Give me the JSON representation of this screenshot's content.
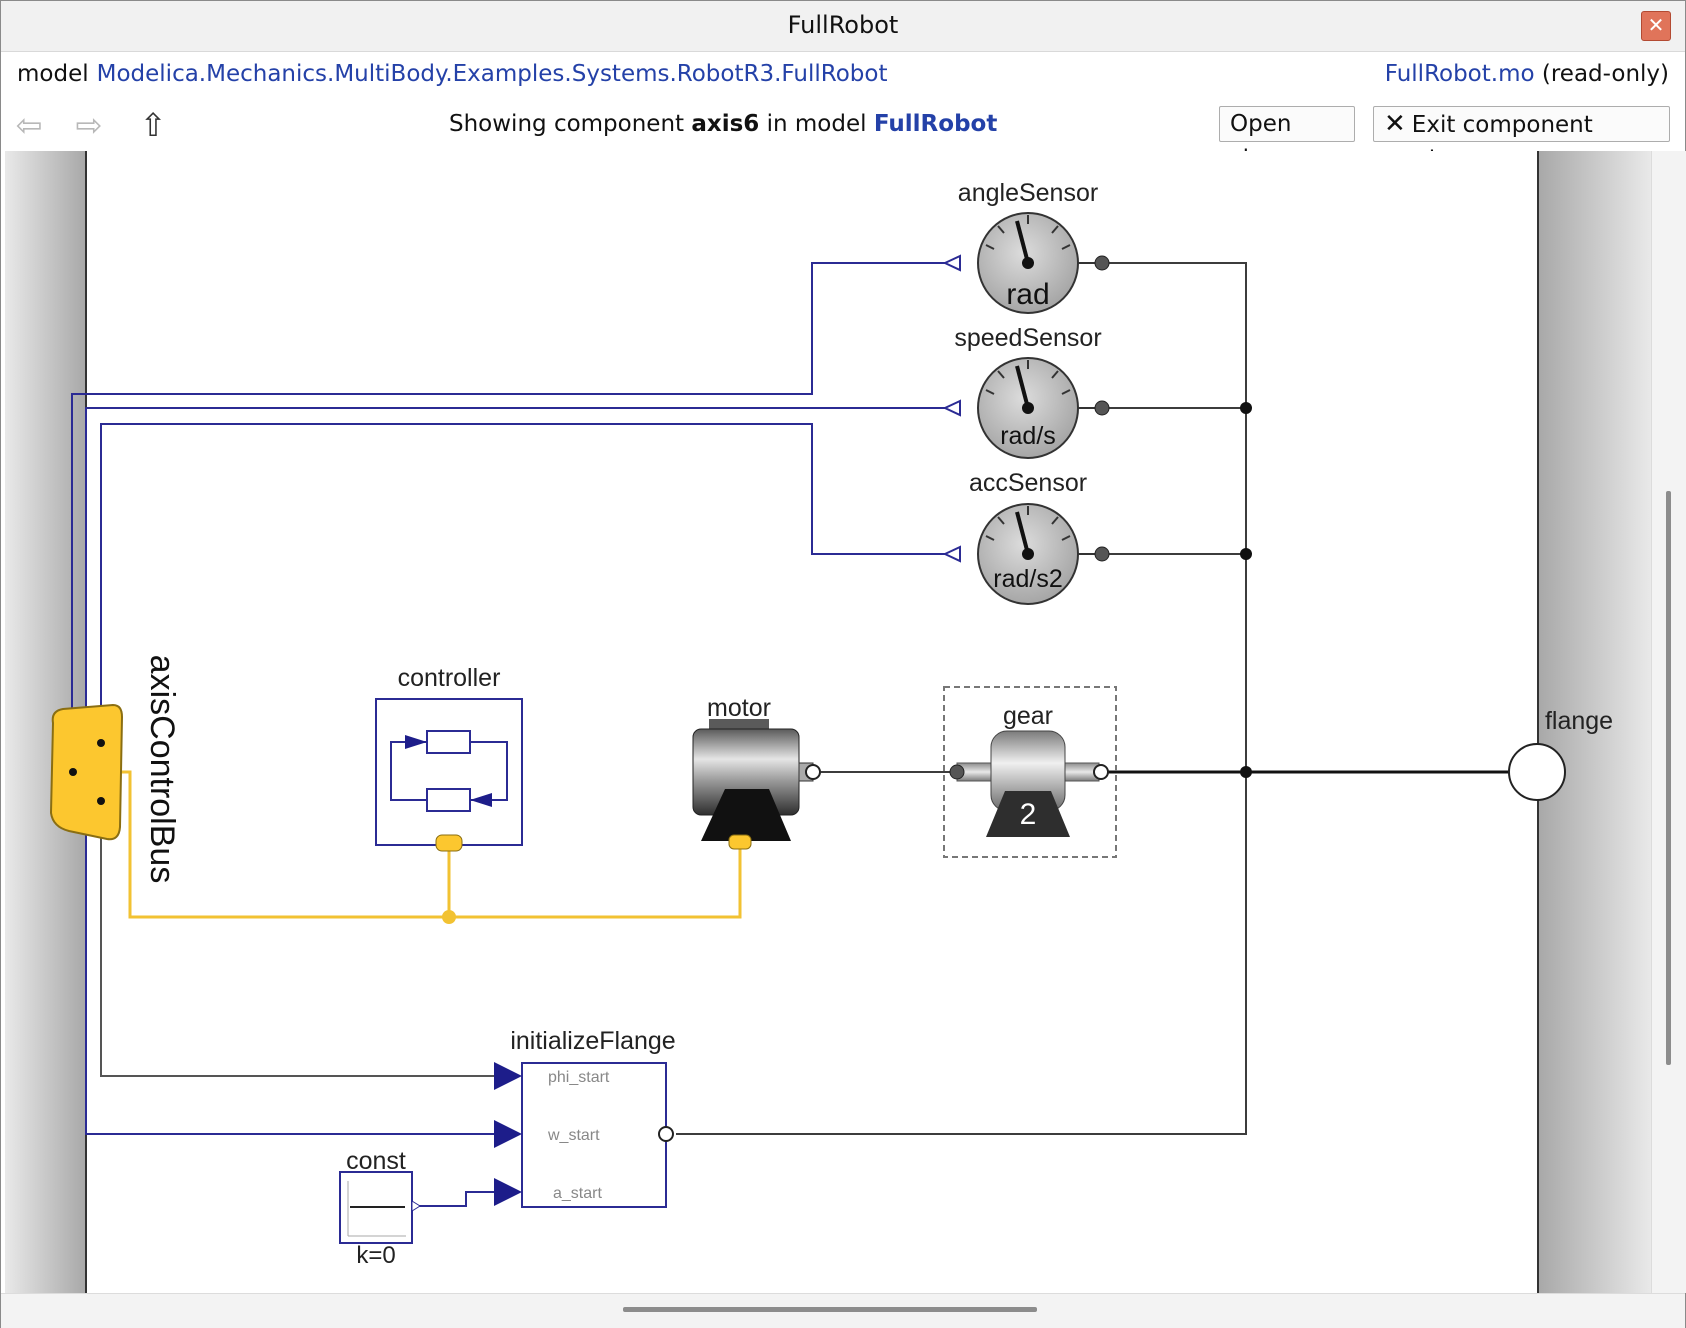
{
  "window": {
    "title": "FullRobot"
  },
  "path": {
    "keyword": "model",
    "class_path": "Modelica.Mechanics.MultiBody.Examples.Systems.RobotR3.FullRobot",
    "file": "FullRobot.mo",
    "file_status": "(read-only)"
  },
  "nav": {
    "back_icon": "arrow-left-icon",
    "forward_icon": "arrow-right-icon",
    "up_icon": "arrow-up-icon",
    "status_prefix": "Showing component",
    "component": "axis6",
    "status_middle": "in model",
    "model": "FullRobot",
    "open_class": "Open class",
    "exit_mode": "Exit component mode"
  },
  "diagram": {
    "components": {
      "angle_sensor": {
        "name": "angleSensor",
        "unit": "rad"
      },
      "speed_sensor": {
        "name": "speedSensor",
        "unit": "rad/s"
      },
      "acc_sensor": {
        "name": "accSensor",
        "unit": "rad/s2"
      },
      "controller": {
        "name": "controller"
      },
      "motor": {
        "name": "motor"
      },
      "gear": {
        "name": "gear",
        "ratio": "2"
      },
      "flange": {
        "name": "flange"
      },
      "bus": {
        "name": "axisControlBus"
      },
      "initialize_flange": {
        "name": "initializeFlange",
        "ports": [
          "phi_start",
          "w_start",
          "a_start"
        ]
      },
      "const": {
        "name": "const",
        "param": "k=0"
      }
    },
    "colors": {
      "signal_line": "#2b2b94",
      "bus_line": "#f2c232",
      "mech_line": "#3c3c3c",
      "block_border": "#2b2b94",
      "bus_fill": "#fcc72f"
    }
  }
}
